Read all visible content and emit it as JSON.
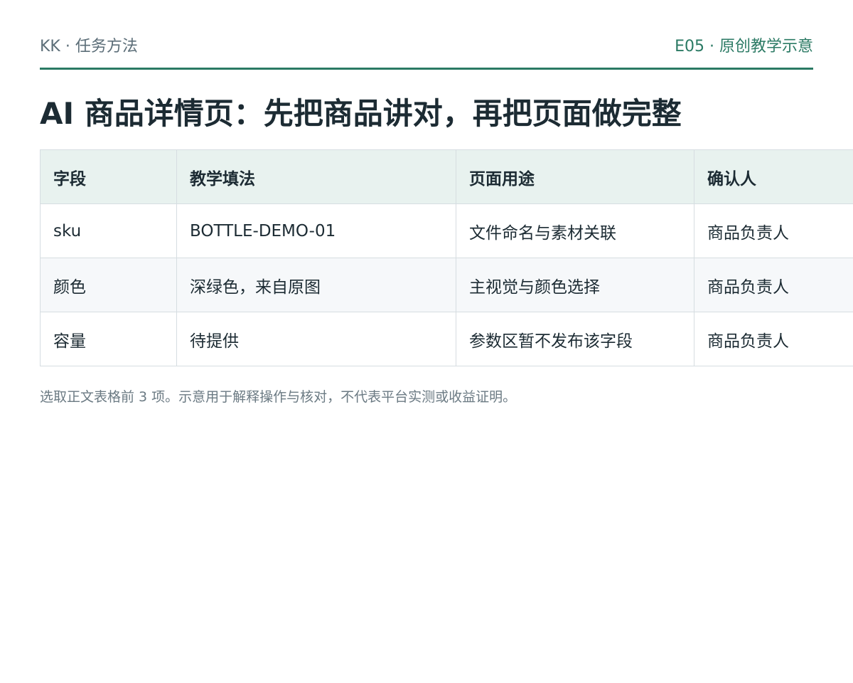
{
  "header": {
    "left": "KK · 任务方法",
    "right": "E05 · 原创教学示意"
  },
  "title": "AI 商品详情页：先把商品讲对，再把页面做完整",
  "table": {
    "columns": [
      "字段",
      "教学填法",
      "页面用途",
      "确认人"
    ],
    "rows": [
      [
        "sku",
        "BOTTLE-DEMO-01",
        "文件命名与素材关联",
        "商品负责人"
      ],
      [
        "颜色",
        "深绿色，来自原图",
        "主视觉与颜色选择",
        "商品负责人"
      ],
      [
        "容量",
        "待提供",
        "参数区暂不发布该字段",
        "商品负责人"
      ]
    ]
  },
  "footnote": "选取正文表格前 3 项。示意用于解释操作与核对，不代表平台实测或收益证明。",
  "colors": {
    "accent": "#2b7a64",
    "header_bg": "#e8f2ef",
    "muted_text": "#5c6e78"
  }
}
